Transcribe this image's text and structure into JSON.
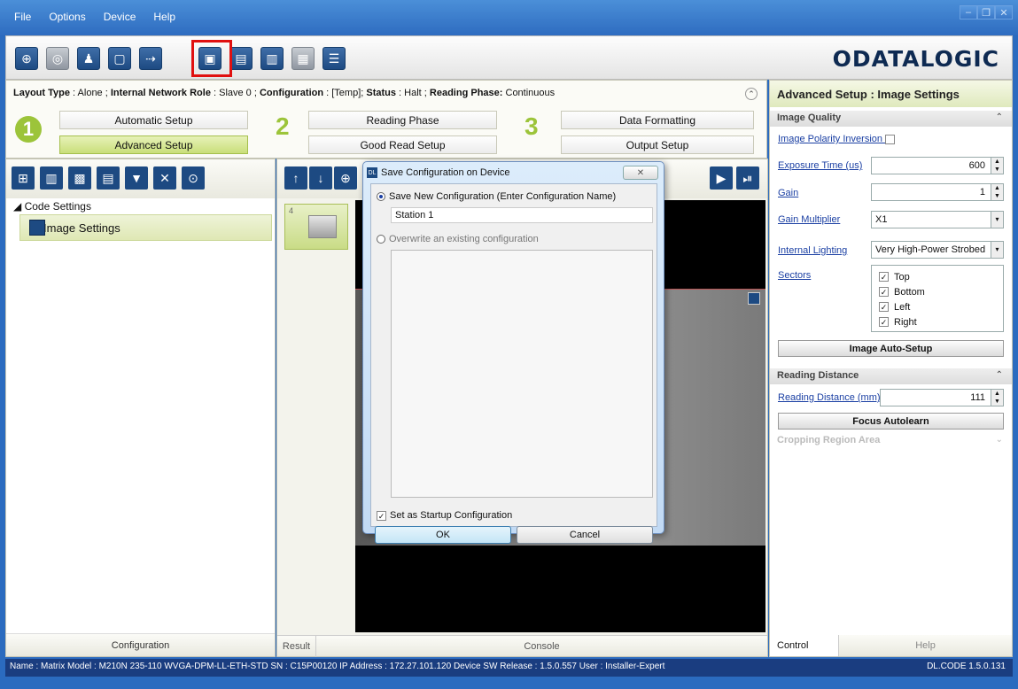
{
  "menubar": {
    "items": [
      "File",
      "Options",
      "Device",
      "Help"
    ]
  },
  "toolbar": {
    "icons": [
      "target-icon",
      "search-device-icon",
      "user-icon",
      "window-icon",
      "send-config-icon",
      "save-config-icon",
      "load-config-icon",
      "monitor-icon",
      "image-icon",
      "settings-icon"
    ]
  },
  "logo": {
    "text": "ODATALOGIC"
  },
  "layout": {
    "info_parts": [
      {
        "label": "Layout Type",
        "value": " : Alone ; "
      },
      {
        "label": "Internal Network Role",
        "value": " : Slave 0 ; "
      },
      {
        "label": "Configuration",
        "value": " : [Temp]; "
      },
      {
        "label": "Status",
        "value": " : Halt ; "
      },
      {
        "label": "Reading Phase:",
        "value": " Continuous"
      }
    ],
    "steps": [
      {
        "num": "1",
        "buttons": [
          "Automatic Setup",
          "Advanced Setup"
        ]
      },
      {
        "num": "2",
        "buttons": [
          "Reading Phase",
          "Good Read Setup"
        ]
      },
      {
        "num": "3",
        "buttons": [
          "Data Formatting",
          "Output Setup"
        ]
      }
    ]
  },
  "left": {
    "tree_root": "◢ Code Settings",
    "tree_item": "Image Settings",
    "footer": "Configuration"
  },
  "center": {
    "thumb_num": "4",
    "tab_result": "Result",
    "tab_console": "Console"
  },
  "right": {
    "title": "Advanced Setup : Image Settings",
    "image_quality": "Image Quality",
    "polarity_label": "Image Polarity Inversion",
    "exposure_label": "Exposure Time (us)",
    "exposure_value": "600",
    "gain_label": "Gain",
    "gain_value": "1",
    "gain_mult_label": "Gain Multiplier",
    "gain_mult_value": "X1",
    "lighting_label": "Internal Lighting",
    "lighting_value": "Very High-Power Strobed",
    "sectors_label": "Sectors",
    "sectors": [
      "Top",
      "Bottom",
      "Left",
      "Right"
    ],
    "auto_setup": "Image Auto-Setup",
    "reading_distance": "Reading Distance",
    "reading_distance_label": "Reading Distance (mm)",
    "reading_distance_value": "111",
    "focus": "Focus Autolearn",
    "cropping": "Cropping Region Area",
    "tab_control": "Control",
    "tab_help": "Help"
  },
  "dialog": {
    "title": "Save Configuration on Device",
    "option_new": "Save New Configuration (Enter Configuration Name)",
    "name_value": "Station 1",
    "option_overwrite": "Overwrite an existing configuration",
    "startup": "Set as Startup Configuration",
    "ok": "OK",
    "cancel": "Cancel"
  },
  "statusbar": {
    "text": "Name : Matrix  Model : M210N 235-110 WVGA-DPM-LL-ETH-STD  SN : C15P00120  IP Address : 172.27.101.120  Device SW Release : 1.5.0.557  User : Installer-Expert",
    "version": "DL.CODE 1.5.0.131"
  }
}
